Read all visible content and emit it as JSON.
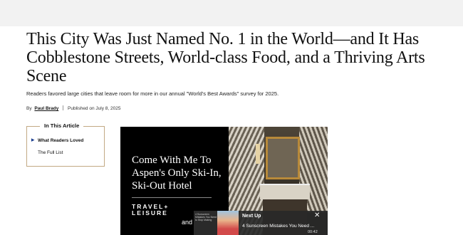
{
  "article": {
    "headline": "This City Was Just Named No. 1 in the World—and It Has Cobblestone Streets, World-class Food, and a Thriving Arts Scene",
    "dek": "Readers favored large cities that leave room for more in our annual \"World's Best Awards\" survey for 2025.",
    "byline_prefix": "By",
    "author": "Paul Brady",
    "published": "Published on July 8, 2025"
  },
  "toc": {
    "title": "In This Article",
    "items": [
      {
        "label": "What Readers Loved",
        "active": true
      },
      {
        "label": "The Full List",
        "active": false
      }
    ]
  },
  "video": {
    "title": "Come With Me To Aspen's Only Ski-In, Ski-Out Hotel",
    "brand_line1": "TRAVEL+",
    "brand_line2": "LEISURE",
    "and_text": "and",
    "thumb_caption": "4 Sunscreen Mistakes You Need to Stop Making",
    "next_label": "Next Up",
    "next_title": "4 Sunscreen Mistakes You Need ...",
    "next_time": "00:42",
    "close_glyph": "✕"
  },
  "colors": {
    "topbar": "#f2f2f2",
    "toc_border": "#c2a984",
    "toc_bullet": "#1a3d8f"
  }
}
